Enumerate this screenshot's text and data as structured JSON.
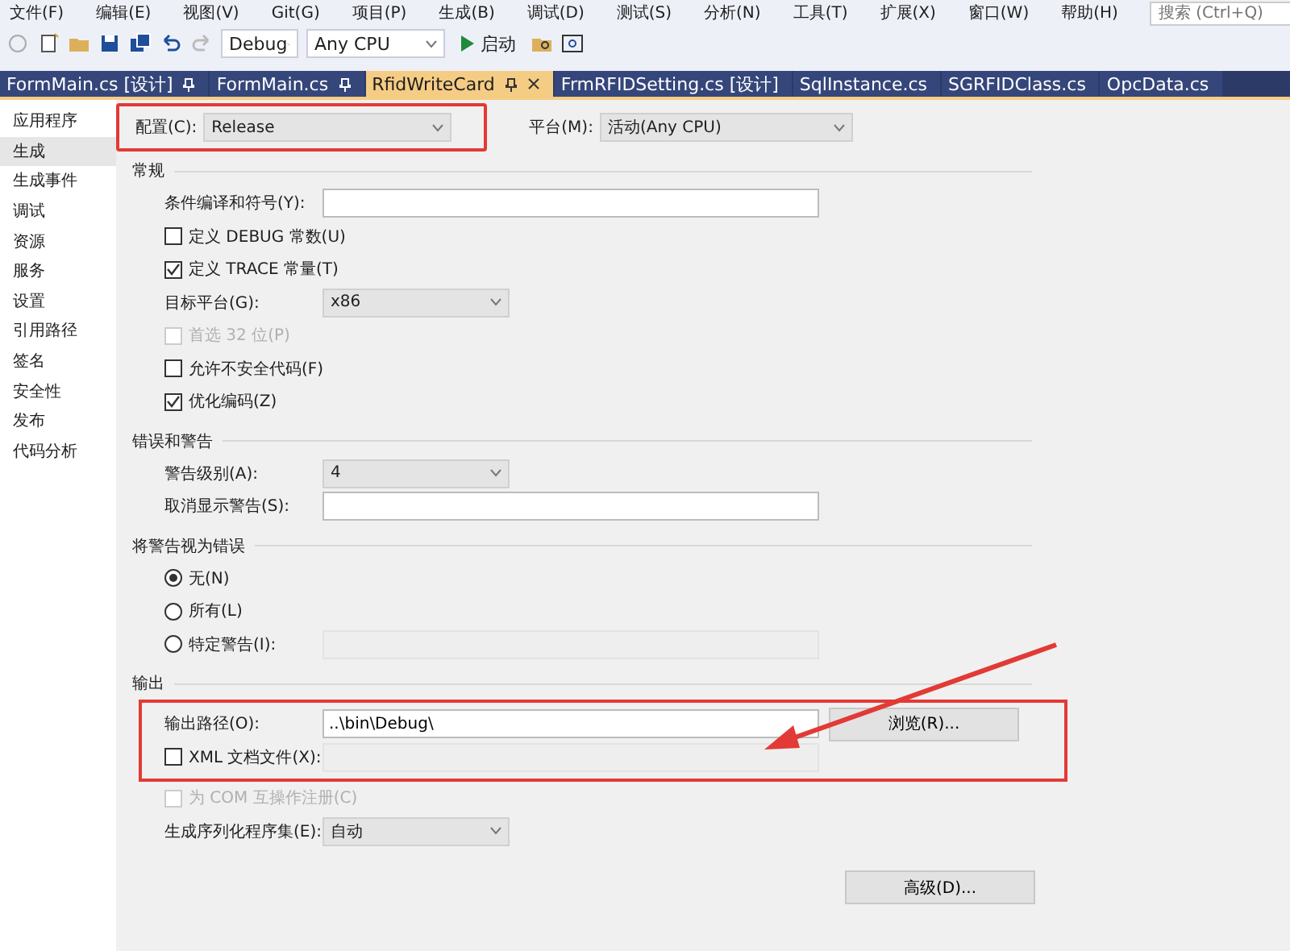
{
  "menu": [
    "文件(F)",
    "编辑(E)",
    "视图(V)",
    "Git(G)",
    "项目(P)",
    "生成(B)",
    "调试(D)",
    "测试(S)",
    "分析(N)",
    "工具(T)",
    "扩展(X)",
    "窗口(W)",
    "帮助(H)"
  ],
  "search": {
    "placeholder": "搜索 (Ctrl+Q)"
  },
  "toolbar": {
    "configuration": "Debug",
    "platform": "Any CPU",
    "start": "启动"
  },
  "tabs": [
    {
      "label": "FormMain.cs [设计]",
      "selected": false,
      "pinned": true
    },
    {
      "label": "FormMain.cs",
      "selected": false,
      "pinned": true
    },
    {
      "label": "RfidWriteCard",
      "selected": true,
      "pinned": true
    },
    {
      "label": "FrmRFIDSetting.cs [设计]",
      "selected": false,
      "pinned": false
    },
    {
      "label": "SqlInstance.cs",
      "selected": false,
      "pinned": false
    },
    {
      "label": "SGRFIDClass.cs",
      "selected": false,
      "pinned": false
    },
    {
      "label": "OpcData.cs",
      "selected": false,
      "pinned": false
    }
  ],
  "sidebar": {
    "items": [
      {
        "label": "应用程序",
        "selected": false
      },
      {
        "label": "生成",
        "selected": true
      },
      {
        "label": "生成事件",
        "selected": false
      },
      {
        "label": "调试",
        "selected": false
      },
      {
        "label": "资源",
        "selected": false
      },
      {
        "label": "服务",
        "selected": false
      },
      {
        "label": "设置",
        "selected": false
      },
      {
        "label": "引用路径",
        "selected": false
      },
      {
        "label": "签名",
        "selected": false
      },
      {
        "label": "安全性",
        "selected": false
      },
      {
        "label": "发布",
        "selected": false
      },
      {
        "label": "代码分析",
        "selected": false
      }
    ]
  },
  "config": {
    "label": "配置(C):",
    "value": "Release",
    "highlighted": true,
    "platform_label": "平台(M):",
    "platform_value": "活动(Any CPU)"
  },
  "sections": [
    {
      "title": "常规",
      "rows": [
        {
          "kind": "field",
          "label": "条件编译和符号(Y):",
          "value": "",
          "highlighted": false
        },
        {
          "kind": "checkbox",
          "label": "定义 DEBUG 常数(U)",
          "checked": false,
          "disabled": false,
          "highlighted": false
        },
        {
          "kind": "checkbox",
          "label": "定义 TRACE 常量(T)",
          "checked": true,
          "disabled": false,
          "highlighted": false
        },
        {
          "kind": "select",
          "label": "目标平台(G):",
          "value": "x86",
          "highlighted": false
        },
        {
          "kind": "checkbox",
          "label": "首选 32 位(P)",
          "checked": false,
          "disabled": true,
          "highlighted": false
        },
        {
          "kind": "checkbox",
          "label": "允许不安全代码(F)",
          "checked": false,
          "disabled": false,
          "highlighted": false
        },
        {
          "kind": "checkbox",
          "label": "优化编码(Z)",
          "checked": true,
          "disabled": false,
          "highlighted": false
        }
      ]
    },
    {
      "title": "错误和警告",
      "rows": [
        {
          "kind": "select",
          "label": "警告级别(A):",
          "value": "4",
          "highlighted": false
        },
        {
          "kind": "field",
          "label": "取消显示警告(S):",
          "value": "",
          "highlighted": false
        }
      ]
    },
    {
      "title": "将警告视为错误",
      "rows": [
        {
          "kind": "radio",
          "label": "无(N)",
          "selected": true,
          "highlighted": false
        },
        {
          "kind": "radio",
          "label": "所有(L)",
          "selected": false,
          "highlighted": false
        },
        {
          "kind": "radio",
          "label": "特定警告(I):",
          "selected": false,
          "field": true,
          "highlighted": false
        }
      ]
    },
    {
      "title": "输出",
      "rows": [
        {
          "kind": "field",
          "label": "输出路径(O):",
          "value": "..\\bin\\Debug\\",
          "button": "浏览(R)...",
          "highlighted": true
        },
        {
          "kind": "checkbox",
          "label": "XML 文档文件(X):",
          "checked": false,
          "disabled": false,
          "field": true,
          "highlighted": true
        },
        {
          "kind": "checkbox",
          "label": "为 COM 互操作注册(C)",
          "checked": false,
          "disabled": true,
          "highlighted": false
        },
        {
          "kind": "select",
          "label": "生成序列化程序集(E):",
          "value": "自动",
          "highlighted": false
        }
      ]
    }
  ],
  "advanced_button": "高级(D)..."
}
